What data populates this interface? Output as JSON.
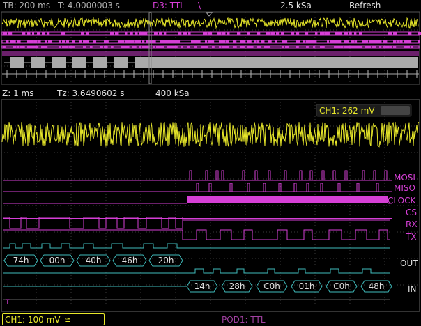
{
  "header": {
    "timebase": "TB: 200 ms",
    "trigger_time": "T: 4.0000003 s",
    "trigger_source": "D3: TTL",
    "trigger_edge_symbol": "\\",
    "sample_rate": "2.5 kSa",
    "mode": "Refresh"
  },
  "zoom_bar": {
    "zoom": "Z: 1 ms",
    "zoom_time": "Tz: 3.6490602 s",
    "zoom_rate": "400 kSa"
  },
  "measurement": {
    "label": "CH1: 262 mV"
  },
  "channel_labels": {
    "mosi": "MOSI",
    "miso": "MISO",
    "clock": "CLOCK",
    "cs": "CS",
    "rx": "RX",
    "tx": "TX",
    "out": "OUT",
    "in": "IN"
  },
  "bus_out_values": [
    "74h",
    "00h",
    "40h",
    "46h",
    "20h"
  ],
  "bus_in_values": [
    "14h",
    "28h",
    "C0h",
    "01h",
    "C0h",
    "48h"
  ],
  "footer": {
    "ch1_setting": "CH1: 100 mV",
    "ch1_coupling_symbol": "≅",
    "pod_label": "POD1: TTL"
  },
  "colors": {
    "yellow": "#e8e82a",
    "magenta": "#d63fd6",
    "cyan": "#3fbcbc",
    "grid": "#3a3a3a"
  },
  "icons": {
    "trigger_marker": "triangle-down-icon",
    "ground_marker": "t-marker-icon"
  }
}
